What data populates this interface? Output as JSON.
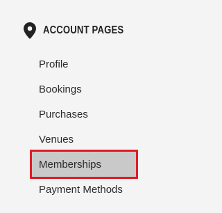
{
  "sidebar": {
    "header_icon": "map-pin-icon",
    "title": "ACCOUNT PAGES",
    "items": [
      {
        "label": "Profile"
      },
      {
        "label": "Bookings"
      },
      {
        "label": "Purchases"
      },
      {
        "label": "Venues"
      },
      {
        "label": "Memberships",
        "highlighted": true
      },
      {
        "label": "Payment Methods"
      }
    ]
  },
  "colors": {
    "background": "#f4f4f4",
    "text": "#2b2b2b",
    "highlight_fill": "#c9c9c9",
    "highlight_border": "#e01b24"
  }
}
